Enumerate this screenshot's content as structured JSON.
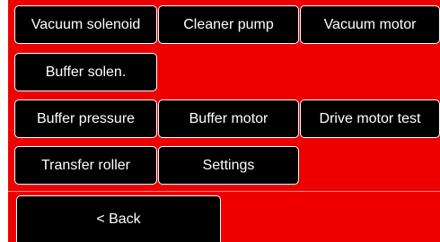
{
  "colors": {
    "background": "#ef0000",
    "button_fill": "#000000",
    "button_text": "#ffffff",
    "button_border": "#ffffff"
  },
  "buttons": {
    "vacuum_solenoid": "Vacuum solenoid",
    "cleaner_pump": "Cleaner pump",
    "vacuum_motor": "Vacuum motor",
    "buffer_solenoid": "Buffer solen.",
    "buffer_pressure": "Buffer pressure",
    "buffer_motor": "Buffer motor",
    "drive_motor_test": "Drive motor test",
    "transfer_roller": "Transfer roller",
    "settings": "Settings",
    "back": "< Back"
  }
}
